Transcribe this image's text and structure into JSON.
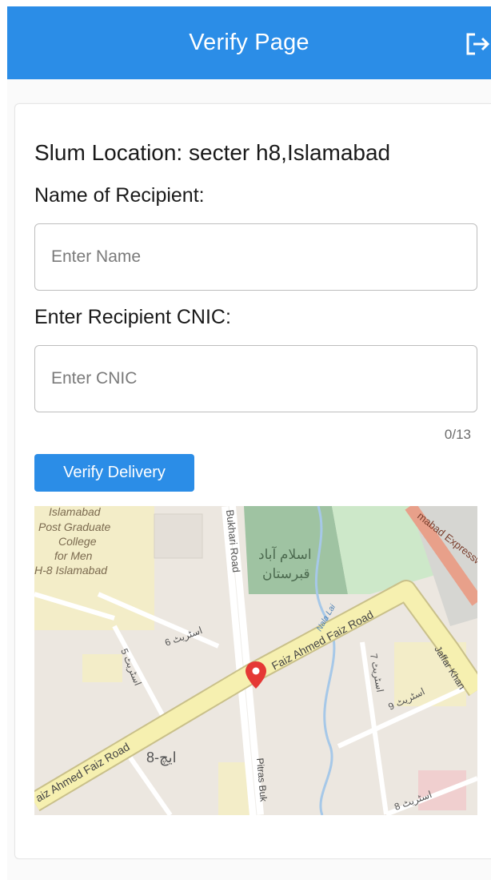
{
  "header": {
    "title": "Verify Page",
    "logout_icon": "logout-icon",
    "color": "#2b8de7"
  },
  "form": {
    "slum_location": "Slum Location: secter h8,Islamabad",
    "name_label": "Name of Recipient:",
    "name_placeholder": "Enter Name",
    "name_value": "",
    "cnic_label": "Enter Recipient CNIC:",
    "cnic_placeholder": "Enter CNIC",
    "cnic_value": "",
    "cnic_counter": "0/13",
    "verify_button": "Verify Delivery"
  },
  "map": {
    "labels": {
      "college_line1": "Islamabad",
      "college_line2": "Post Graduate",
      "college_line3": "College",
      "college_line4": "for Men",
      "college_line5": "H-8 Islamabad",
      "bukhari_road": "Bukhari Road",
      "graveyard_line1": "اسلام آباد",
      "graveyard_line2": "قبرستان",
      "expressway": "mabad Expressway",
      "nala_lai": "Nala Lai",
      "faiz_road_east": "Faiz Ahmed Faiz Road",
      "faiz_road_west": "aiz Ahmed Faiz Road",
      "jaffar_khan": "Jaffar Khan",
      "street_6": "اسٹریٹ 6",
      "street_5": "اسٹریٹ 5",
      "street_7": "اسٹریٹ 7",
      "street_9": "اسٹریٹ 9",
      "street_8": "اسٹریٹ 8",
      "h8": "ایچ-8",
      "pitras_bukhari": "Pitras Buk"
    },
    "marker_icon": "map-pin-icon",
    "marker_color": "#e53935"
  }
}
